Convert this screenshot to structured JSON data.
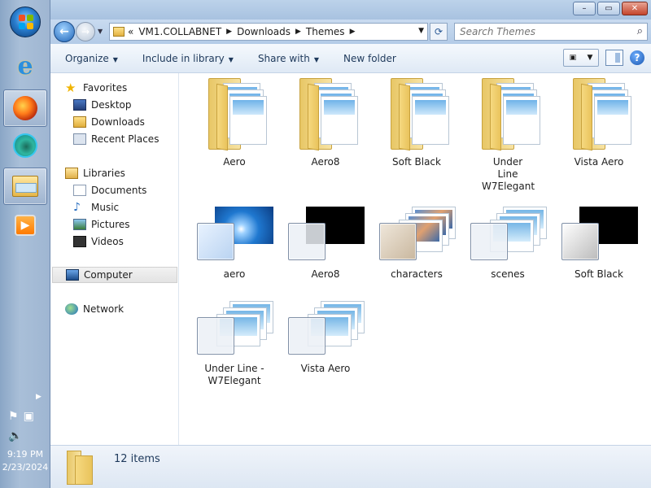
{
  "taskbar": {
    "clock_time": "9:19 PM",
    "clock_date": "2/23/2024",
    "pinned": [
      "start-orb",
      "internet-explorer",
      "firefox",
      "edge",
      "windows-explorer",
      "media-player"
    ]
  },
  "window": {
    "caption": {
      "minimize": "–",
      "maximize": "▭",
      "close": "✕"
    },
    "breadcrumb": [
      "VM1.COLLABNET",
      "Downloads",
      "Themes"
    ],
    "breadcrumb_prefix": "«",
    "search_placeholder": "Search Themes",
    "toolbar": {
      "organize": "Organize",
      "include_in_library": "Include in library",
      "share_with": "Share with",
      "new_folder": "New folder"
    }
  },
  "navpane": {
    "favorites": {
      "label": "Favorites",
      "items": [
        "Desktop",
        "Downloads",
        "Recent Places"
      ]
    },
    "libraries": {
      "label": "Libraries",
      "items": [
        "Documents",
        "Music",
        "Pictures",
        "Videos"
      ]
    },
    "computer": "Computer",
    "network": "Network"
  },
  "content": {
    "folders": [
      "Aero",
      "Aero8",
      "Soft Black",
      "Under Line W7Elegant",
      "Vista Aero"
    ],
    "themes": [
      "aero",
      "Aero8",
      "characters",
      "scenes",
      "Soft Black",
      "Under Line - W7Elegant",
      "Vista Aero"
    ]
  },
  "details": {
    "count": "12 items"
  },
  "colors": {
    "accent": "#1e395b",
    "titlebar": "#bcd2ea",
    "selection": "#e3e3e3"
  }
}
